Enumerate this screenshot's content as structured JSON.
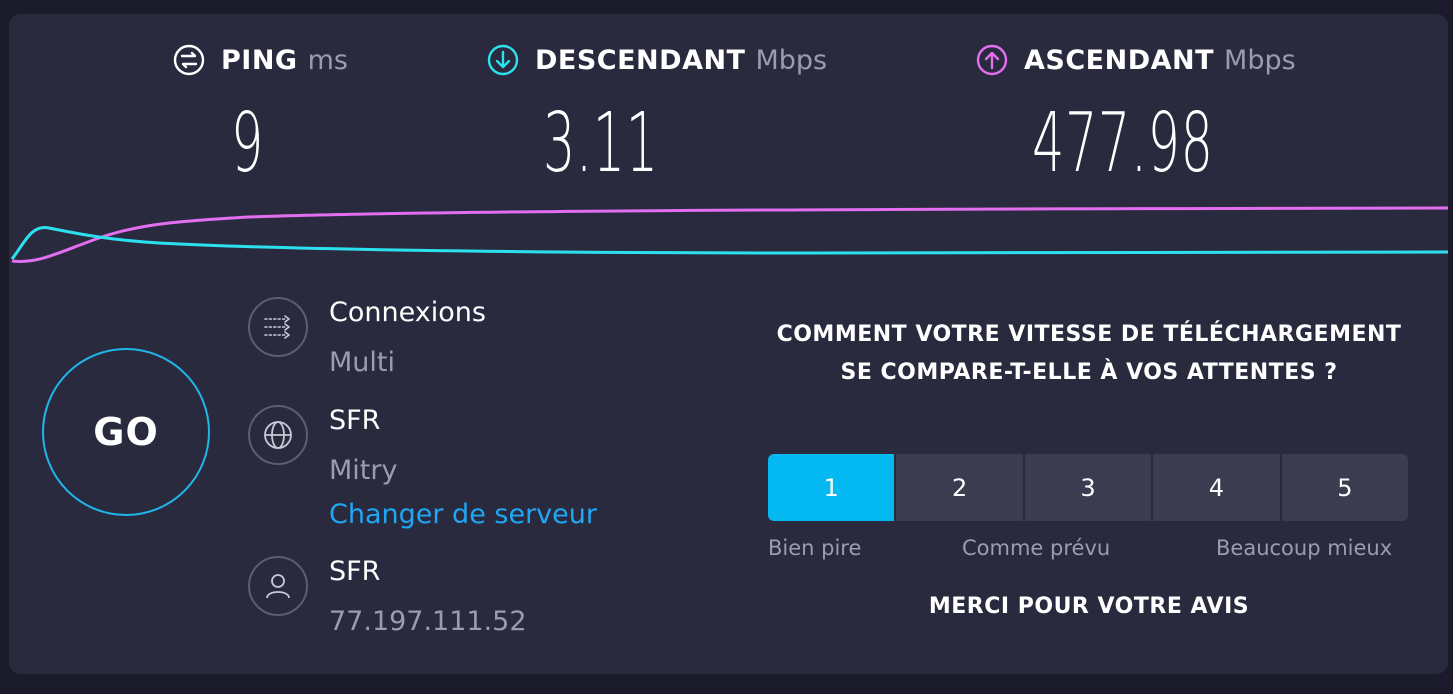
{
  "metrics": {
    "ping": {
      "name": "PING",
      "unit": "ms",
      "value": "9",
      "icon": "ping-icon",
      "color": "#ffffff"
    },
    "download": {
      "name": "DESCENDANT",
      "unit": "Mbps",
      "value": "3.11",
      "icon": "download-arrow-icon",
      "color": "#2de0f0"
    },
    "upload": {
      "name": "ASCENDANT",
      "unit": "Mbps",
      "value": "477.98",
      "icon": "upload-arrow-icon",
      "color": "#e36ef0"
    }
  },
  "graph": {
    "download_color": "#2de0f0",
    "upload_color": "#e36ef0"
  },
  "go_button": {
    "label": "GO",
    "color": "#1fb6ea"
  },
  "connections": {
    "title": "Connexions",
    "value": "Multi",
    "icon": "connections-icon"
  },
  "server": {
    "title": "SFR",
    "location": "Mitry",
    "change_link": "Changer de serveur",
    "icon": "globe-icon"
  },
  "provider": {
    "title": "SFR",
    "ip": "77.197.111.52",
    "icon": "user-icon"
  },
  "feedback": {
    "question": "COMMENT VOTRE VITESSE DE TÉLÉCHARGEMENT SE COMPARE-T-ELLE À VOS ATTENTES ?",
    "options": [
      "1",
      "2",
      "3",
      "4",
      "5"
    ],
    "selected": "1",
    "label_low": "Bien pire",
    "label_mid": "Comme prévu",
    "label_high": "Beaucoup mieux",
    "thanks": "MERCI POUR VOTRE AVIS",
    "accent": "#04b8f1"
  }
}
